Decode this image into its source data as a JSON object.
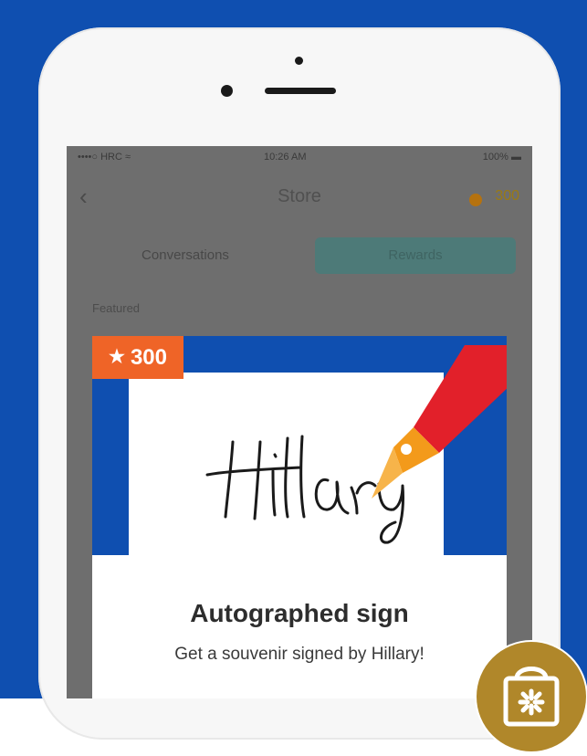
{
  "status_bar": {
    "carrier": "••••○ HRC ≈",
    "time": "10:26 AM",
    "battery": "100% ▬"
  },
  "nav": {
    "back_icon": "chevron-left-icon",
    "title": "Store",
    "coins": "300"
  },
  "tabs": [
    "Conversations",
    "Rewards"
  ],
  "section_label": "Featured",
  "card": {
    "badge": "300",
    "badge_icon": "star-icon",
    "signature_text": "Hillary",
    "title": "Autographed sign",
    "subtitle": "Get a souvenir signed by Hillary!"
  },
  "colors": {
    "brand_blue": "#0f4fb0",
    "badge_orange": "#ef6427",
    "pen_red": "#e2202a",
    "nib_orange": "#f39a1b",
    "shop_gold": "#b0872a"
  },
  "shop_icon": "shopping-bag-icon"
}
